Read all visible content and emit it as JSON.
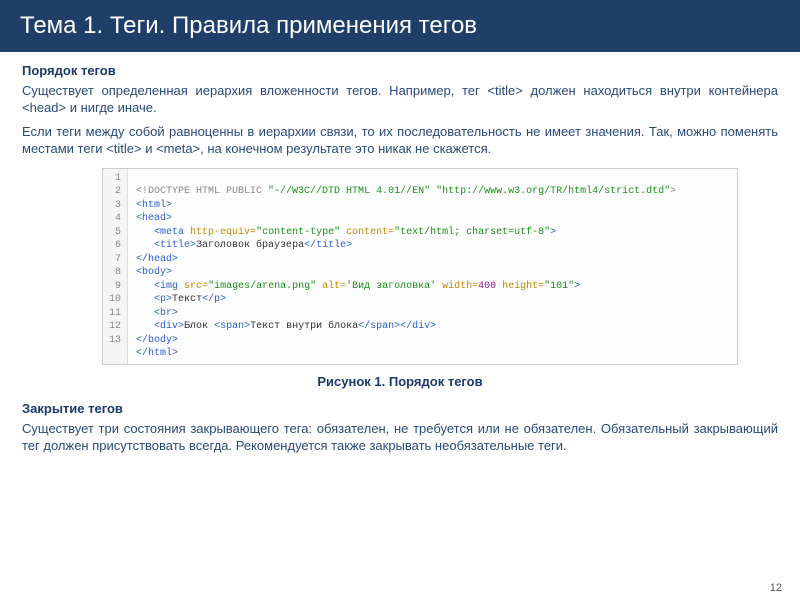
{
  "header": {
    "title": "Тема 1. Теги. Правила применения тегов"
  },
  "section1": {
    "heading": "Порядок тегов",
    "p1": "Существует определенная иерархия вложенности тегов. Например, тег <title> должен находиться внутри контейнера <head> и нигде иначе.",
    "p2": "Если теги между собой равноценны в иерархии связи, то их последовательность не имеет значения. Так, можно поменять местами теги <title> и <meta>, на конечном результате это никак не скажется."
  },
  "code": {
    "lines": [
      "1",
      "2",
      "3",
      "4",
      "5",
      "6",
      "7",
      "8",
      "9",
      "10",
      "11",
      "12",
      "13"
    ],
    "l1a": "<!DOCTYPE HTML PUBLIC ",
    "l1b": "\"-//W3C//DTD HTML 4.01//EN\" \"http://www.w3.org/TR/html4/strict.dtd\"",
    "l1c": ">",
    "l2": "<html>",
    "l3": "<head>",
    "l4a": "<meta ",
    "l4b": "http-equiv=",
    "l4c": "\"content-type\"",
    "l4d": " content=",
    "l4e": "\"text/html; charset=utf-8\"",
    "l4f": ">",
    "l5a": "<title>",
    "l5b": "Заголовок браузера",
    "l5c": "</title>",
    "l6": "</head>",
    "l7": "<body>",
    "l8a": "<img ",
    "l8b": "src=",
    "l8c": "\"images/arena.png\"",
    "l8d": " alt=",
    "l8e": "'Вид заголовка'",
    "l8f": " width=",
    "l8g": "400",
    "l8h": " height=",
    "l8i": "\"101\"",
    "l8j": ">",
    "l9a": "<p>",
    "l9b": "Текст",
    "l9c": "</p>",
    "l10": "<br>",
    "l11a": "<div>",
    "l11b": "Блок ",
    "l11c": "<span>",
    "l11d": "Текст внутри блока",
    "l11e": "</span></div>",
    "l12": "</body>",
    "l13": "</html>"
  },
  "caption": "Рисунок 1. Порядок тегов",
  "section2": {
    "heading": "Закрытие тегов",
    "p1": "Существует три состояния закрывающего тега: обязателен, не требуется или не обязателен. Обязательный закрывающий тег должен присутствовать всегда. Рекомендуется также закрывать необязательные теги."
  },
  "pagenum": "12"
}
